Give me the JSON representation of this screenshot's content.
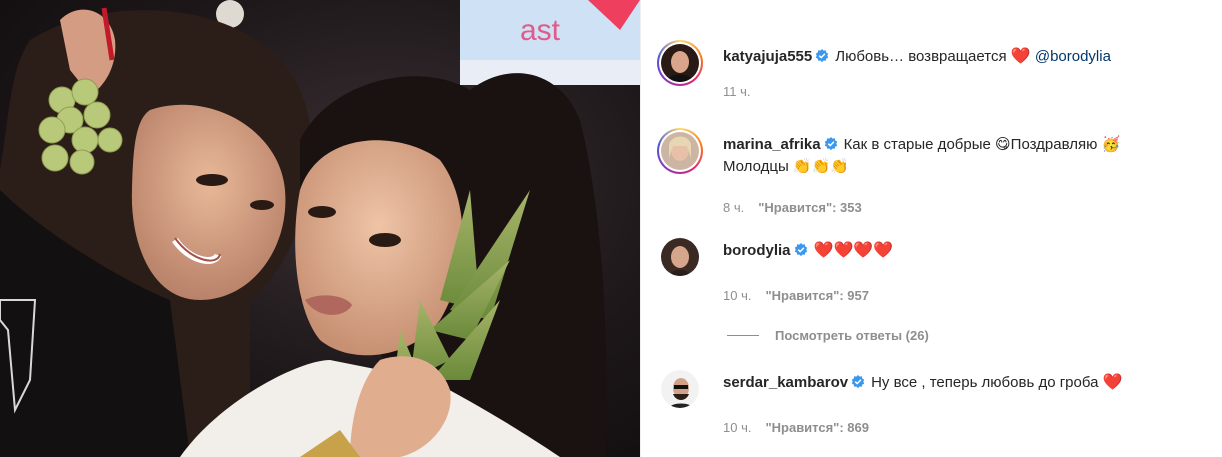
{
  "photo": {
    "alt": "",
    "sign_text": "ast"
  },
  "comments": [
    {
      "username": "katyajuja555",
      "verified": true,
      "text": "Любовь… возвращается",
      "emoji": "❤️",
      "mention": "@borodylia",
      "time": "11 ч.",
      "likes": ""
    },
    {
      "username": "marina_afrika",
      "verified": true,
      "text": "Как в старые добрые",
      "emoji1": "😋",
      "text2": "Поздравляю",
      "emoji2": "🥳",
      "text3": "Молодцы",
      "emoji3": "👏👏👏",
      "time": "8 ч.",
      "likes": "\"Нравится\": 353"
    },
    {
      "username": "borodylia",
      "verified": true,
      "emoji": "❤️❤️❤️❤️",
      "time": "10 ч.",
      "likes": "\"Нравится\": 957",
      "replies": "Посмотреть ответы (26)"
    },
    {
      "username": "serdar_kambarov",
      "verified": true,
      "text": "Ну все , теперь любовь до гроба",
      "emoji": "❤️",
      "time": "10 ч.",
      "likes": "\"Нравится\": 869"
    }
  ],
  "colors": {
    "verified_blue": "#3897f0",
    "mention": "#00376b",
    "meta_gray": "#8e8e8e",
    "heart": "#ed1c24"
  }
}
